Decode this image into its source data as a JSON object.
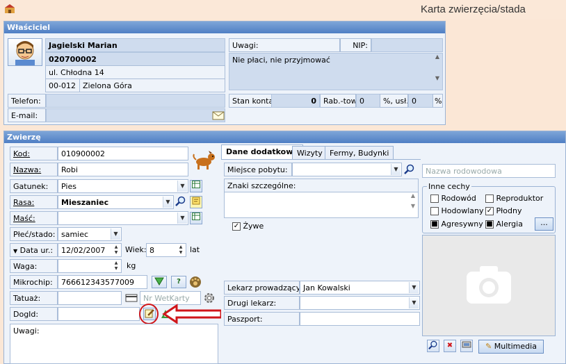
{
  "window": {
    "title": "Karta zwierzęcia/stada"
  },
  "owner": {
    "header": "Właściciel",
    "name": "Jagielski Marian",
    "code": "020700002",
    "street": "ul. Chłodna 14",
    "postal": "00-012",
    "city": "Zielona Góra",
    "notes_label": "Uwagi:",
    "notes": "Nie płaci, nie przyjmować",
    "nip_label": "NIP:",
    "nip": "",
    "phone_label": "Telefon:",
    "phone": "",
    "email_label": "E-mail:",
    "email": "",
    "balance_label": "Stan konta:",
    "balance": "0",
    "discount_label": "Rab.-tow.",
    "discount": "0",
    "discount2_label": "%, usł.:",
    "discount2": "0",
    "percent": "%"
  },
  "animal": {
    "header": "Zwierzę",
    "kod_label": "Kod:",
    "kod": "010900002",
    "nazwa_label": "Nazwa:",
    "nazwa": "Robi",
    "gatunek_label": "Gatunek:",
    "gatunek": "Pies",
    "rasa_label": "Rasa:",
    "rasa": "Mieszaniec",
    "masc_label": "Maść:",
    "masc": "",
    "plec_label": "Płeć/stado:",
    "plec": "samiec",
    "dataur_label": "Data ur.:",
    "dataur": "12/02/2007",
    "wiek_label": "Wiek:",
    "wiek": "8",
    "lat": "lat",
    "waga_label": "Waga:",
    "waga": "",
    "kg": "kg",
    "mikrochip_label": "Mikrochip:",
    "mikrochip": "766612343577009",
    "tatuaz_label": "Tatuaż:",
    "tatuaz": "",
    "wetkarta_placeholder": "Nr WetKarty",
    "dogid_label": "DogId:",
    "dogid": "",
    "uwagi_label": "Uwagi:",
    "uwagi": ""
  },
  "tabs": [
    {
      "label": "Dane dodatkowe"
    },
    {
      "label": "Wizyty"
    },
    {
      "label": "Fermy, Budynki"
    }
  ],
  "extra": {
    "miejsce_label": "Miejsce pobytu:",
    "miejsce": "",
    "znaki_label": "Znaki szczególne:",
    "znaki": "",
    "zywe_label": "Żywe",
    "lekarz_label": "Lekarz prowadzący:",
    "lekarz": "Jan Kowalski",
    "drugi_label": "Drugi lekarz:",
    "drugi": "",
    "paszport_label": "Paszport:",
    "paszport": ""
  },
  "pedigree_placeholder": "Nazwa rodowodowa",
  "traits": {
    "title": "Inne cechy",
    "rodowod": "Rodowód",
    "reproduktor": "Reproduktor",
    "hodowlany": "Hodowlany",
    "plodny": "Płodny",
    "agresywny": "Agresywny",
    "alergia": "Alergia",
    "more": "..."
  },
  "multimedia_label": "Multimedia",
  "colors": {
    "accent": "#4f7fc4",
    "highlight_red": "#d0161a"
  }
}
